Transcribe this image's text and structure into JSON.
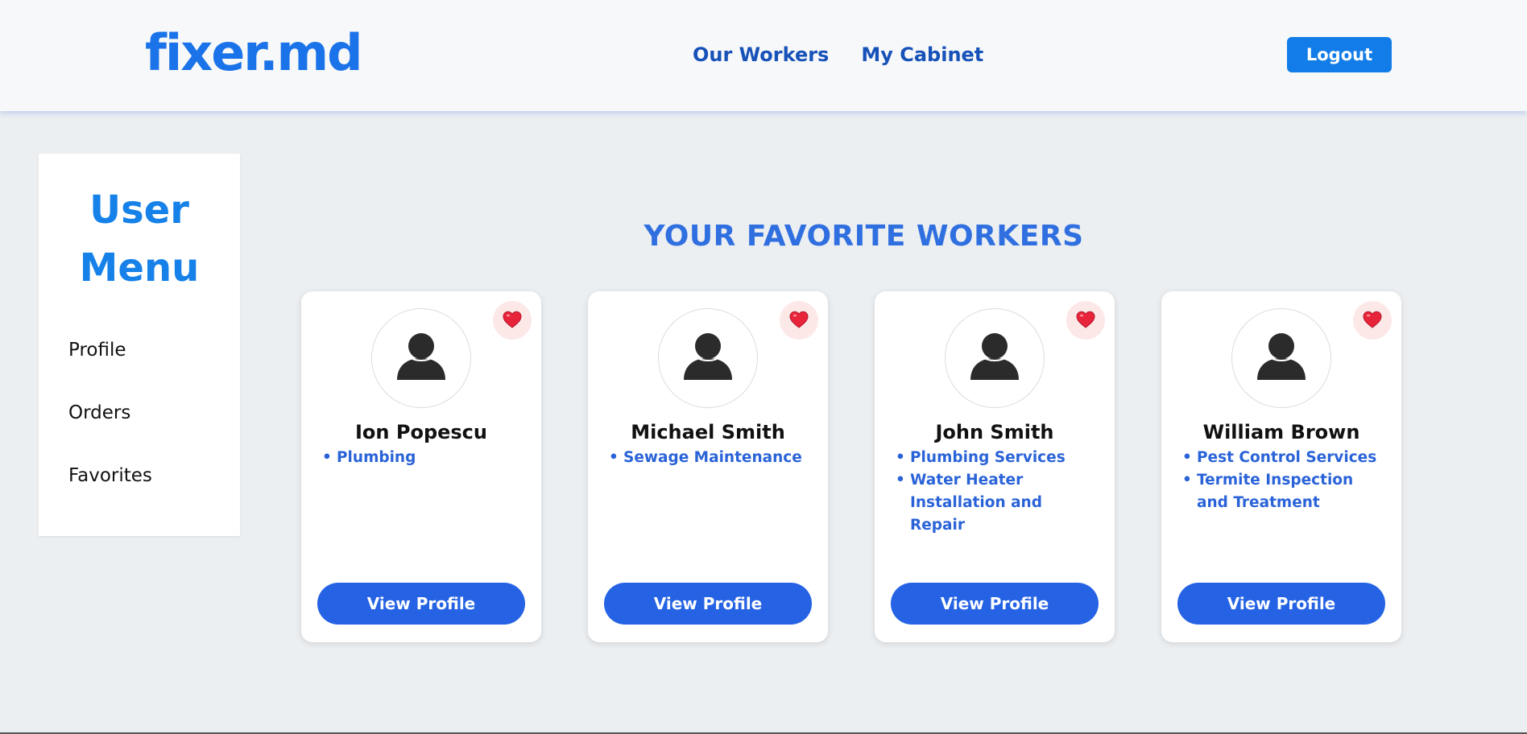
{
  "header": {
    "logo": "fixer.md",
    "nav": [
      "Our Workers",
      "My Cabinet"
    ],
    "logout_label": "Logout"
  },
  "sidebar": {
    "title": "User Menu",
    "items": [
      "Profile",
      "Orders",
      "Favorites"
    ]
  },
  "main": {
    "section_title": "YOUR FAVORITE WORKERS",
    "workers": [
      {
        "name": "Ion Popescu",
        "services": [
          "Plumbing"
        ],
        "button": "View Profile"
      },
      {
        "name": "Michael Smith",
        "services": [
          "Sewage Maintenance"
        ],
        "button": "View Profile"
      },
      {
        "name": "John Smith",
        "services": [
          "Plumbing Services",
          "Water Heater Installation and Repair"
        ],
        "button": "View Profile"
      },
      {
        "name": "William Brown",
        "services": [
          "Pest Control Services",
          "Termite Inspection and Treatment"
        ],
        "button": "View Profile"
      }
    ]
  },
  "icons": {
    "favorite": "heart-icon",
    "avatar": "user-silhouette-icon"
  },
  "colors": {
    "brand": "#1a73e8",
    "nav_link": "#1652b8",
    "button": "#2563e4",
    "service_text": "#2a63d8",
    "heart": "#e8243a"
  }
}
